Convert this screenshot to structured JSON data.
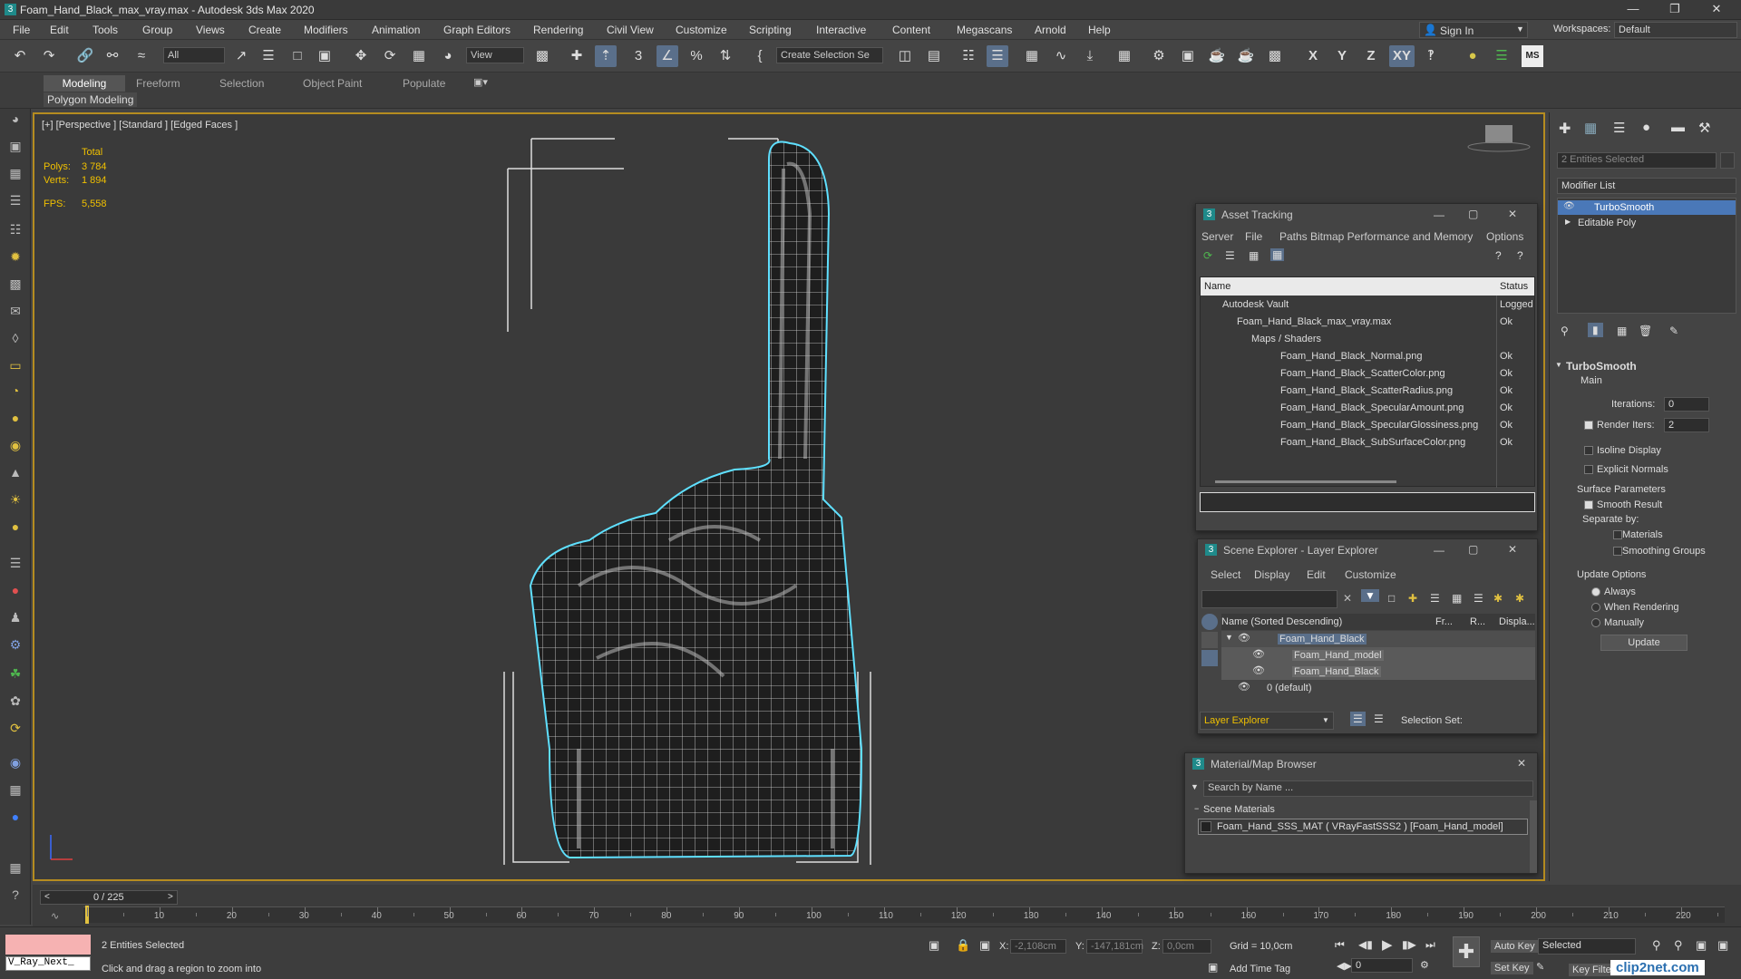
{
  "window": {
    "title": "Foam_Hand_Black_max_vray.max - Autodesk 3ds Max 2020"
  },
  "menu": [
    "File",
    "Edit",
    "Tools",
    "Group",
    "Views",
    "Create",
    "Modifiers",
    "Animation",
    "Graph Editors",
    "Rendering",
    "Civil View",
    "Customize",
    "Scripting",
    "Interactive",
    "Content",
    "Megascans",
    "Arnold",
    "Help"
  ],
  "account": {
    "sign_in": "Sign In",
    "workspaces_label": "Workspaces:",
    "workspace": "Default"
  },
  "toolbar": {
    "filter": "All",
    "refcoord": "View",
    "selection_set": "Create Selection Se",
    "axes": [
      "X",
      "Y",
      "Z",
      "XY"
    ],
    "ms": "MS"
  },
  "ribbon": {
    "tabs": [
      "Modeling",
      "Freeform",
      "Selection",
      "Object Paint",
      "Populate"
    ],
    "sub": "Polygon Modeling"
  },
  "viewport": {
    "label": "[+] [Perspective ] [Standard ] [Edged Faces ]",
    "stats": {
      "total": "Total",
      "polys_label": "Polys:",
      "polys": "3 784",
      "verts_label": "Verts:",
      "verts": "1 894",
      "fps_label": "FPS:",
      "fps": "5,558"
    }
  },
  "asset_tracking": {
    "title": "Asset Tracking",
    "menu": [
      "Server",
      "File",
      "Paths",
      "Bitmap Performance and Memory",
      "Options"
    ],
    "col_name": "Name",
    "col_status": "Status",
    "rows": [
      {
        "name": "Autodesk Vault",
        "status": "Logged"
      },
      {
        "name": "Foam_Hand_Black_max_vray.max",
        "status": "Ok"
      },
      {
        "name": "Maps / Shaders",
        "status": ""
      },
      {
        "name": "Foam_Hand_Black_Normal.png",
        "status": "Ok"
      },
      {
        "name": "Foam_Hand_Black_ScatterColor.png",
        "status": "Ok"
      },
      {
        "name": "Foam_Hand_Black_ScatterRadius.png",
        "status": "Ok"
      },
      {
        "name": "Foam_Hand_Black_SpecularAmount.png",
        "status": "Ok"
      },
      {
        "name": "Foam_Hand_Black_SpecularGlossiness.png",
        "status": "Ok"
      },
      {
        "name": "Foam_Hand_Black_SubSurfaceColor.png",
        "status": "Ok"
      }
    ]
  },
  "scene_explorer": {
    "title": "Scene Explorer - Layer Explorer",
    "menu": [
      "Select",
      "Display",
      "Edit",
      "Customize"
    ],
    "col_name": "Name (Sorted Descending)",
    "col_fr": "Fr...",
    "col_r": "R...",
    "col_disp": "Displa...",
    "rows": [
      "Foam_Hand_Black",
      "Foam_Hand_model",
      "Foam_Hand_Black",
      "0 (default)"
    ],
    "footer_dd": "Layer Explorer",
    "selection_set": "Selection Set:"
  },
  "material_browser": {
    "title": "Material/Map Browser",
    "search": "Search by Name ...",
    "section": "Scene Materials",
    "item": "Foam_Hand_SSS_MAT ( VRayFastSSS2 ) [Foam_Hand_model]"
  },
  "command_panel": {
    "selected": "2 Entities Selected",
    "modifier_list": "Modifier List",
    "stack": [
      "TurboSmooth",
      "Editable Poly"
    ],
    "rollout": "TurboSmooth",
    "main": "Main",
    "iterations_label": "Iterations:",
    "iterations": "0",
    "render_iters_label": "Render Iters:",
    "render_iters": "2",
    "isoline": "Isoline Display",
    "explicit": "Explicit Normals",
    "surface": "Surface Parameters",
    "smooth_result": "Smooth Result",
    "separate_by": "Separate by:",
    "materials": "Materials",
    "smoothing_groups": "Smoothing Groups",
    "update_options": "Update Options",
    "always": "Always",
    "when_rendering": "When Rendering",
    "manually": "Manually",
    "update": "Update"
  },
  "timeline": {
    "frame": "0 / 225",
    "ticks": [
      "10",
      "20",
      "30",
      "40",
      "50",
      "60",
      "70",
      "80",
      "90",
      "100",
      "110",
      "120",
      "130",
      "140",
      "150",
      "160",
      "170",
      "180",
      "190",
      "200",
      "210",
      "220"
    ]
  },
  "status": {
    "script": "V_Ray_Next_",
    "selected": "2 Entities Selected",
    "prompt": "Click and drag a region to zoom into",
    "x_label": "X:",
    "x": "-2,108cm",
    "y_label": "Y:",
    "y": "-147,181cm",
    "z_label": "Z:",
    "z": "0,0cm",
    "grid": "Grid = 10,0cm",
    "add_time_tag": "Add Time Tag",
    "auto_key": "Auto Key",
    "selected_dd": "Selected",
    "set_key": "Set Key",
    "key_filters": "Key Filters...",
    "frame": "0"
  },
  "watermark": "clip2net.com"
}
